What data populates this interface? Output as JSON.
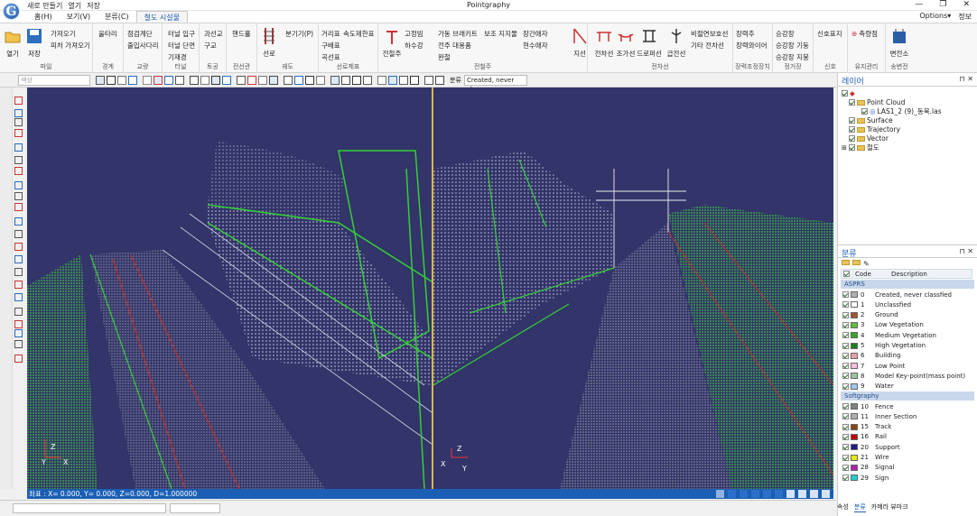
{
  "app": {
    "title": "Pointgraphy",
    "logo_letter": "G",
    "quick_access": [
      "새로 만들기",
      "열기",
      "저장"
    ],
    "window_controls": [
      "—",
      "❐",
      "✕"
    ]
  },
  "menu": {
    "tabs": [
      "홈(H)",
      "보기(V)",
      "분류(C)",
      "철도 시설물"
    ],
    "active_tab": 3,
    "options_label": "Options",
    "info_label": "정보"
  },
  "ribbon": {
    "file": {
      "label": "파일",
      "open": "열기",
      "save": "저장",
      "items": [
        "가져오기",
        "피처 가져오기"
      ]
    },
    "boundary": {
      "label": "경계",
      "items": [
        "울타리"
      ]
    },
    "bridge": {
      "label": "교량",
      "items": [
        "점검계단",
        "출입사다리"
      ]
    },
    "tunnel": {
      "label": "터널",
      "items": [
        "터널 입구",
        "터널 단면",
        "기재경"
      ]
    },
    "earthwork": {
      "label": "토공",
      "items": [
        "과선교",
        "구교"
      ]
    },
    "crossing": {
      "label": "전선관",
      "items": [
        "핸드홀"
      ]
    },
    "track": {
      "label": "궤도",
      "items": [
        "선로",
        "분기기(P)"
      ]
    },
    "signs": {
      "label": "선로제표",
      "items": [
        "거리표",
        "속도제한표",
        "구배표",
        "곡선표"
      ]
    },
    "catenary": {
      "label": "전철주",
      "items": [
        "전철주",
        "고정빔",
        "하수강",
        "가동 브래키트",
        "전주 대용품",
        "완철",
        "보조 지지물",
        "장간애자",
        "현수애자"
      ]
    },
    "wires": {
      "label": "전차선",
      "items": [
        "지선",
        "전차선",
        "조가선",
        "드로퍼선",
        "급전선",
        "비절연보호선",
        "기타 전차선"
      ]
    },
    "tension": {
      "label": "장력조정장치",
      "items": [
        "장력추",
        "장력와이어"
      ]
    },
    "platform": {
      "label": "정거장",
      "items": [
        "승강장",
        "승강장 기둥",
        "승강장 지붕"
      ]
    },
    "signal": {
      "label": "신호",
      "items": [
        "신호표지"
      ]
    },
    "maint": {
      "label": "유지관리",
      "items": [
        "측량점"
      ]
    },
    "substation": {
      "label": "송변전",
      "items": [
        "변전소"
      ]
    }
  },
  "toolbar": {
    "search_placeholder": "색상",
    "classify_label": "분류",
    "classify_value": "Created, never clas"
  },
  "status": {
    "coords": "좌표 : X= 0.000, Y= 0.000, Z=0.000, D=1.000000"
  },
  "viewport": {
    "axis_left": {
      "z": "Z",
      "y": "Y",
      "x": "X"
    },
    "axis_right": {
      "z": "Z",
      "x": "X",
      "y": "Y"
    }
  },
  "layers": {
    "title": "레이어",
    "tree": [
      "Point Cloud",
      "LAS1_2 (9)_동북.las",
      "Surface",
      "Trajectory",
      "Vector",
      "철도"
    ]
  },
  "classify": {
    "title": "분류",
    "col_code": "Code",
    "col_desc": "Description",
    "groups": [
      {
        "name": "ASPRS",
        "rows": [
          {
            "code": "0",
            "desc": "Created, never classfied",
            "color": "#b0b0b0"
          },
          {
            "code": "1",
            "desc": "Unclassfied",
            "color": "#ffffff"
          },
          {
            "code": "2",
            "desc": "Ground",
            "color": "#a0522d"
          },
          {
            "code": "3",
            "desc": "Low Vegetation",
            "color": "#5bbf3a"
          },
          {
            "code": "4",
            "desc": "Medium Vegetation",
            "color": "#3aa52a"
          },
          {
            "code": "5",
            "desc": "High Vegetation",
            "color": "#1e7e1e"
          },
          {
            "code": "6",
            "desc": "Building",
            "color": "#f0a0a0"
          },
          {
            "code": "7",
            "desc": "Low Point",
            "color": "#f5c0e0"
          },
          {
            "code": "8",
            "desc": "Model Key-point(mass point)",
            "color": "#9ac89a"
          },
          {
            "code": "9",
            "desc": "Water",
            "color": "#a0c8f0"
          }
        ]
      },
      {
        "name": "Softgraphy",
        "rows": [
          {
            "code": "10",
            "desc": "Fence",
            "color": "#808080"
          },
          {
            "code": "11",
            "desc": "Inner Section",
            "color": "#b0b0b0"
          },
          {
            "code": "15",
            "desc": "Track",
            "color": "#8b4513"
          },
          {
            "code": "16",
            "desc": "Rail",
            "color": "#c00000"
          },
          {
            "code": "20",
            "desc": "Support",
            "color": "#1e1e8c"
          },
          {
            "code": "21",
            "desc": "Wire",
            "color": "#e8e800"
          },
          {
            "code": "28",
            "desc": "Signal",
            "color": "#b020b0"
          },
          {
            "code": "29",
            "desc": "Sign",
            "color": "#20d0d0"
          }
        ]
      }
    ]
  },
  "panel_tabs": [
    "속성",
    "분류",
    "카메라 뷰마크"
  ],
  "colors": {
    "accent": "#1f5fb4",
    "status_bar": "#1b5fb5",
    "viewport_bg": "#32346a"
  }
}
